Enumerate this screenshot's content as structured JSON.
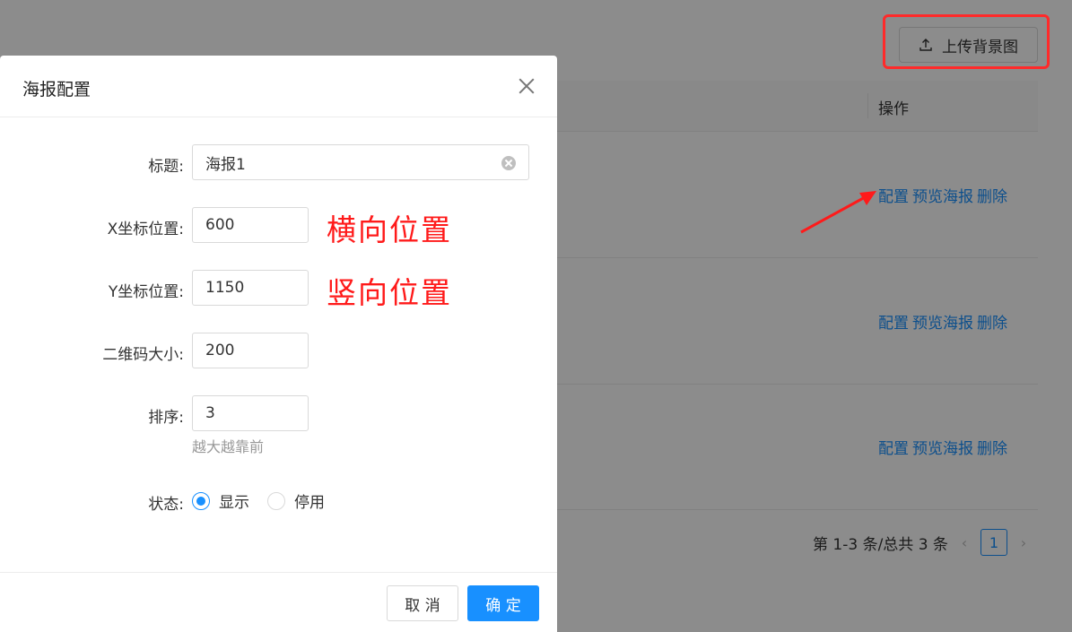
{
  "page": {
    "upload_button_label": "上传背景图",
    "table_header_operation": "操作",
    "rows": [
      {
        "config": "配置",
        "preview": "预览海报",
        "delete": "删除"
      },
      {
        "config": "配置",
        "preview": "预览海报",
        "delete": "删除"
      },
      {
        "config": "配置",
        "preview": "预览海报",
        "delete": "删除"
      }
    ],
    "pagination": {
      "summary": "第 1-3 条/总共 3 条",
      "current_page": "1",
      "prev": "‹",
      "next": "›"
    }
  },
  "modal": {
    "title": "海报配置",
    "fields": {
      "title_label": "标题:",
      "title_value": "海报1",
      "x_label": "X坐标位置:",
      "x_value": "600",
      "y_label": "Y坐标位置:",
      "y_value": "1150",
      "qr_label": "二维码大小:",
      "qr_value": "200",
      "sort_label": "排序:",
      "sort_value": "3",
      "sort_help": "越大越靠前",
      "status_label": "状态:",
      "status_options": [
        "显示",
        "停用"
      ],
      "status_selected": "显示"
    },
    "footer": {
      "cancel_label": "取 消",
      "ok_label": "确 定"
    }
  },
  "annotations": {
    "x_note": "横向位置",
    "y_note": "竖向位置"
  },
  "colors": {
    "primary": "#1890ff",
    "annotation_red": "#ff1a1a"
  }
}
